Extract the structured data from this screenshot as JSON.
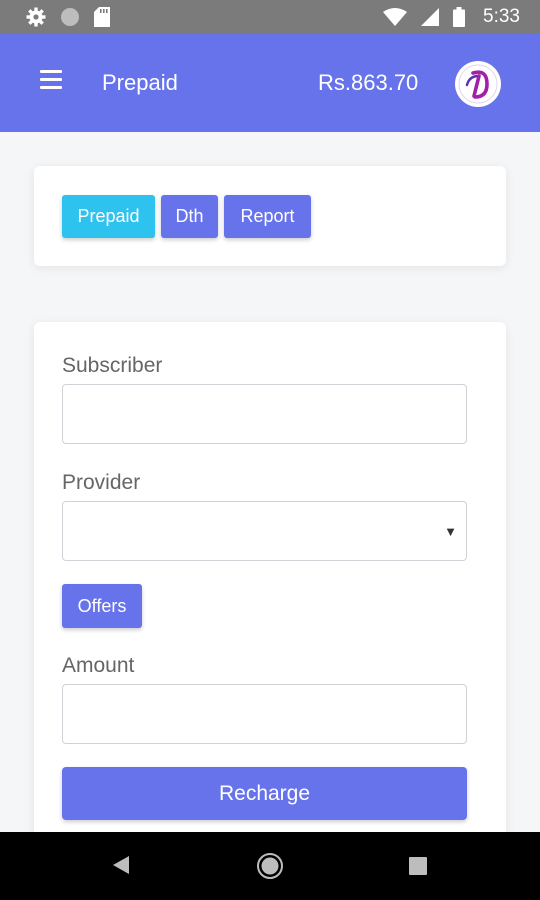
{
  "status_bar": {
    "time": "5:33",
    "left_icons": [
      "gear-icon",
      "circle-icon",
      "sd-card-icon"
    ],
    "right_icons": [
      "wifi-icon",
      "signal-icon",
      "battery-icon"
    ]
  },
  "app_bar": {
    "title": "Prepaid",
    "balance": "Rs.863.70",
    "logo_icon": "app-logo-icon",
    "background_color": "#6673ea"
  },
  "tabs": [
    {
      "label": "Prepaid",
      "active": true,
      "color": "#2ec2ef"
    },
    {
      "label": "Dth",
      "active": false,
      "color": "#6673ea"
    },
    {
      "label": "Report",
      "active": false,
      "color": "#6673ea"
    }
  ],
  "form": {
    "subscriber_label": "Subscriber",
    "subscriber_value": "",
    "provider_label": "Provider",
    "provider_value": "",
    "offers_label": "Offers",
    "amount_label": "Amount",
    "amount_value": "",
    "recharge_label": "Recharge"
  },
  "nav_bar": {
    "icons": [
      "back-icon",
      "home-icon",
      "recents-icon"
    ]
  }
}
